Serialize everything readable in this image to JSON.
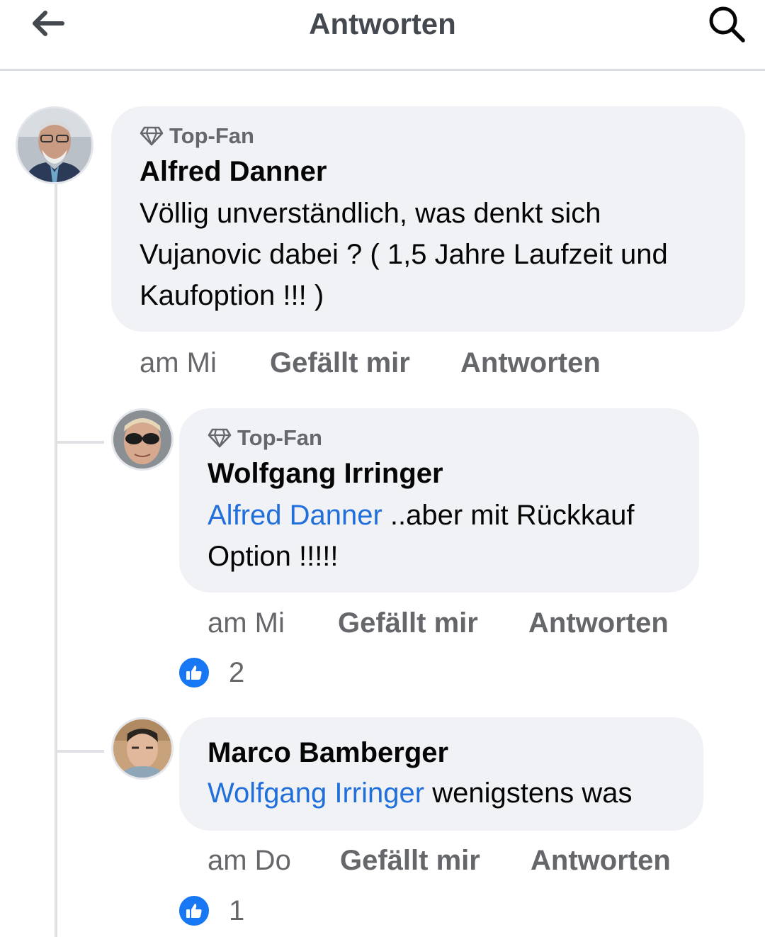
{
  "header": {
    "title": "Antworten",
    "back_icon": "arrow-left-icon",
    "search_icon": "search-icon"
  },
  "comments": [
    {
      "badge": "Top-Fan",
      "author": "Alfred Danner",
      "mention": "",
      "text_lines": [
        "Völlig unverständlich, was denkt sich",
        "Vujanovic dabei ? ( 1,5 Jahre Laufzeit und",
        "Kaufoption !!! )"
      ],
      "time": "am Mi",
      "like_label": "Gefällt mir",
      "reply_label": "Antworten",
      "likes": ""
    },
    {
      "badge": "Top-Fan",
      "author": "Wolfgang Irringer",
      "mention": "Alfred Danner",
      "text_first": " ..aber mit Rückkauf",
      "text_second": "Option !!!!!",
      "time": "am Mi",
      "like_label": "Gefällt mir",
      "reply_label": "Antworten",
      "likes": "2"
    },
    {
      "badge": "",
      "author": "Marco Bamberger",
      "mention": "Wolfgang Irringer",
      "text_first": " wenigstens was",
      "time": "am Do",
      "like_label": "Gefällt mir",
      "reply_label": "Antworten",
      "likes": "1"
    }
  ],
  "colors": {
    "mention": "#216fdb",
    "like_blue": "#1877f2",
    "bubble_bg": "#f0f2f5",
    "meta_gray": "#65676b"
  }
}
